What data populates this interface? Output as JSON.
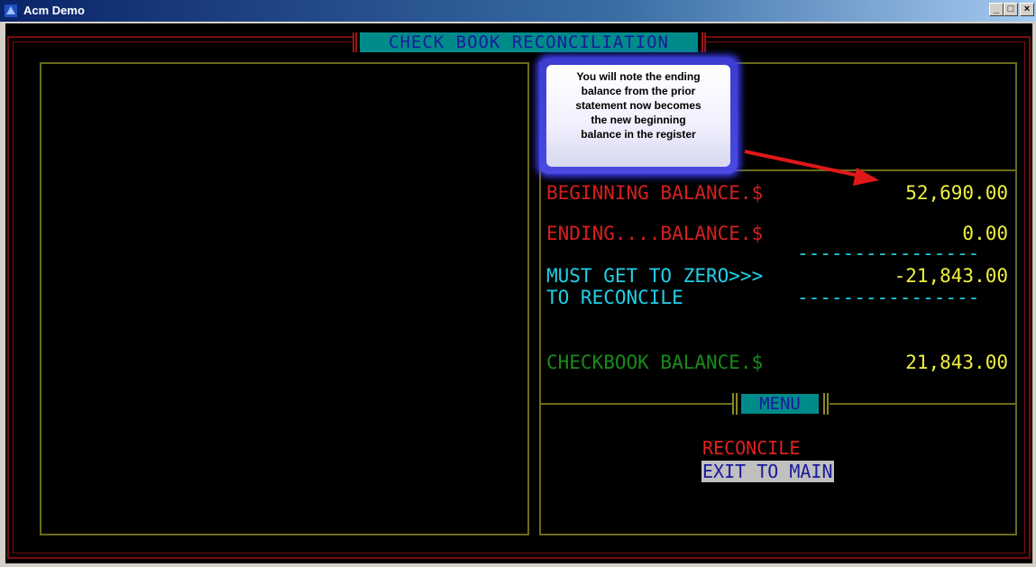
{
  "window": {
    "title": "Acm Demo",
    "minimize": "_",
    "maximize": "□",
    "close": "×"
  },
  "header": {
    "title": "CHECK BOOK RECONCILIATION"
  },
  "balances": {
    "beginning_label": "BEGINNING BALANCE.$",
    "beginning_value": "52,690.00",
    "ending_label": "ENDING....BALANCE.$",
    "ending_value": "0.00",
    "dash_line": "----------------",
    "zero_label": "MUST GET TO ZERO>>>",
    "zero_value": "-21,843.00",
    "reconcile_label": "TO RECONCILE",
    "checkbook_label": "CHECKBOOK BALANCE.$",
    "checkbook_value": "21,843.00"
  },
  "menu": {
    "title": "MENU",
    "items": [
      "RECONCILE",
      "EXIT TO MAIN"
    ]
  },
  "callout": {
    "lines": [
      "You will note the ending",
      "balance from the prior",
      "statement now becomes",
      "the new beginning",
      "balance in the register"
    ]
  },
  "colors": {
    "label_red": "#d42020",
    "label_cyan": "#20d0e8",
    "label_green": "#1a8a1a",
    "value_yellow": "#f0f040",
    "panel_border": "#6b6b1a",
    "frame_red": "#7a0c0c",
    "header_bg": "#008b8b"
  }
}
